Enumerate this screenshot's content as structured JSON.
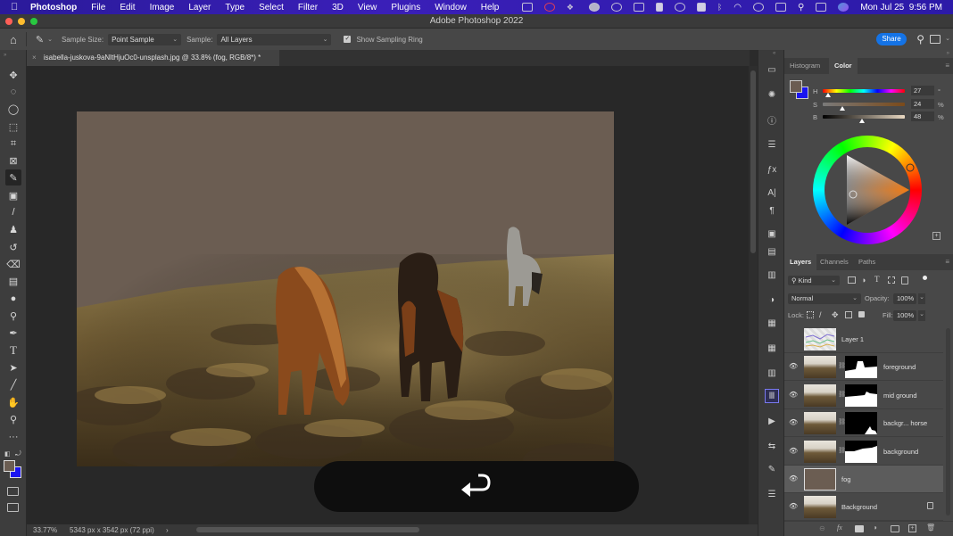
{
  "menubar": {
    "app_name": "Photoshop",
    "items": [
      "File",
      "Edit",
      "Image",
      "Layer",
      "Type",
      "Select",
      "Filter",
      "3D",
      "View",
      "Plugins",
      "Window",
      "Help"
    ],
    "clock": "Mon Jul 25  9:56 PM",
    "status_icons": [
      "camera-icon",
      "activity-icon",
      "dropbox-icon",
      "globe-icon",
      "screen-record-icon",
      "airplay-icon",
      "bookmark-icon",
      "gauge-icon",
      "grid-icon",
      "bluetooth-icon",
      "wifi-icon",
      "user-icon",
      "battery-icon",
      "spotlight-icon",
      "control-center-icon",
      "siri-icon"
    ]
  },
  "window": {
    "title": "Adobe Photoshop 2022"
  },
  "options_bar": {
    "sample_size_label": "Sample Size:",
    "sample_size_value": "Point Sample",
    "sample_label": "Sample:",
    "sample_value": "All Layers",
    "show_sampling_ring_label": "Show Sampling Ring",
    "show_sampling_ring_checked": true,
    "share_label": "Share"
  },
  "document": {
    "tab_title": "isabella-juskova-9aNltHjuOc0-unsplash.jpg @ 33.8% (fog, RGB/8*) *",
    "close_glyph": "×"
  },
  "status_bar": {
    "zoom": "33.77%",
    "doc_info": "5343 px x 3542 px (72 ppi)",
    "arrow": "›"
  },
  "tools": [
    {
      "name": "move-tool",
      "glyph": "✥"
    },
    {
      "name": "marquee-tool",
      "glyph": "◌"
    },
    {
      "name": "lasso-tool",
      "glyph": "◯"
    },
    {
      "name": "object-select-tool",
      "glyph": "⬚"
    },
    {
      "name": "crop-tool",
      "glyph": "⌗"
    },
    {
      "name": "frame-tool",
      "glyph": "⊠"
    },
    {
      "name": "eyedropper-tool",
      "glyph": "✎",
      "active": true
    },
    {
      "name": "healing-tool",
      "glyph": "▣"
    },
    {
      "name": "brush-tool",
      "glyph": "/"
    },
    {
      "name": "stamp-tool",
      "glyph": "♟"
    },
    {
      "name": "history-brush-tool",
      "glyph": "↺"
    },
    {
      "name": "eraser-tool",
      "glyph": "⌫"
    },
    {
      "name": "gradient-tool",
      "glyph": "▤"
    },
    {
      "name": "blur-tool",
      "glyph": "●"
    },
    {
      "name": "dodge-tool",
      "glyph": "⚲"
    },
    {
      "name": "pen-tool",
      "glyph": "✒"
    },
    {
      "name": "type-tool",
      "glyph": "T"
    },
    {
      "name": "path-select-tool",
      "glyph": "➤"
    },
    {
      "name": "line-tool",
      "glyph": "╱"
    },
    {
      "name": "hand-tool",
      "glyph": "✋"
    },
    {
      "name": "zoom-tool",
      "glyph": "⚲"
    },
    {
      "name": "more-tools",
      "glyph": "···"
    }
  ],
  "colors": {
    "foreground": "#6b5d52",
    "background": "#1a14f0",
    "accent": "#1473e6"
  },
  "color_panel": {
    "tabs": [
      "Histogram",
      "Color"
    ],
    "active_tab": "Color",
    "h_label": "H",
    "s_label": "S",
    "b_label": "B",
    "h_value": "27",
    "s_value": "24",
    "b_value": "48",
    "h_unit": "°",
    "s_unit": "%",
    "b_unit": "%",
    "h_fraction": 0.075,
    "s_fraction": 0.24,
    "b_fraction": 0.48
  },
  "layers_panel": {
    "tabs": [
      "Layers",
      "Channels",
      "Paths"
    ],
    "active_tab": "Layers",
    "filter_label": "Kind",
    "blend_mode": "Normal",
    "opacity_label": "Opacity:",
    "opacity_value": "100%",
    "lock_label": "Lock:",
    "fill_label": "Fill:",
    "fill_value": "100%",
    "layers": [
      {
        "name": "Layer 1",
        "visible": false,
        "has_mask": false,
        "type": "chart"
      },
      {
        "name": "foreground",
        "visible": true,
        "has_mask": true,
        "type": "photo"
      },
      {
        "name": "mid ground",
        "visible": true,
        "has_mask": true,
        "type": "photo"
      },
      {
        "name": "backgr... horse",
        "visible": true,
        "has_mask": true,
        "type": "photo"
      },
      {
        "name": "background",
        "visible": true,
        "has_mask": true,
        "type": "photo"
      },
      {
        "name": "fog",
        "visible": true,
        "has_mask": false,
        "type": "fill",
        "selected": true
      },
      {
        "name": "Background",
        "visible": true,
        "has_mask": false,
        "type": "photo",
        "locked": true
      }
    ],
    "footer_icons": [
      "link-layers-icon",
      "fx-icon",
      "add-mask-icon",
      "adjustment-layer-icon",
      "new-group-icon",
      "new-layer-icon",
      "delete-layer-icon"
    ]
  },
  "side_icons": [
    "comments-icon",
    "brush-settings-icon",
    "info-icon",
    "properties-icon",
    "styles-icon",
    "character-icon",
    "paragraph-icon",
    "libraries-icon",
    "notes-icon",
    "glyphs-icon",
    "adjustments-icon",
    "swatches-icon",
    "patterns-icon",
    "gradients-icon",
    "channels-icon",
    "actions-icon",
    "history-icon",
    "brushes-icon",
    "properties-sliders-icon"
  ],
  "undo_overlay": {
    "icon": "undo-arrow-icon"
  }
}
